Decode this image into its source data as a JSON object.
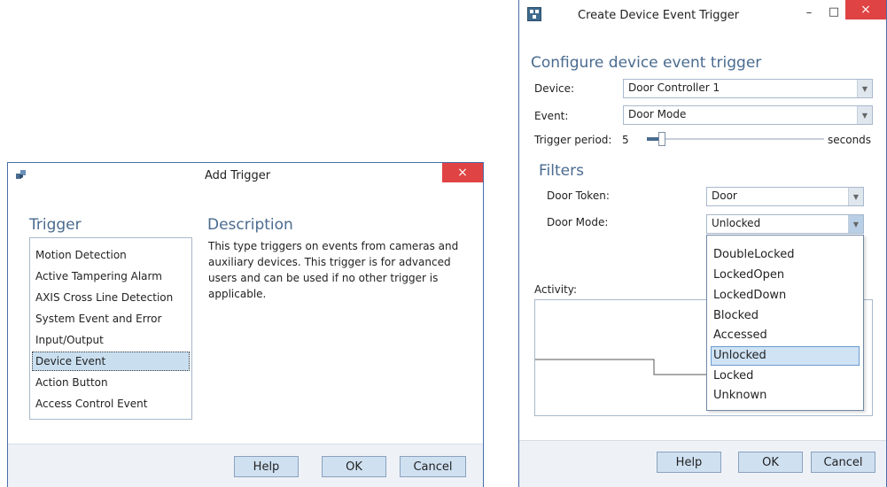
{
  "add_trigger": {
    "title": "Add Trigger",
    "close_glyph": "×",
    "icon_name": "puzzle-icon",
    "trigger_heading": "Trigger",
    "description_heading": "Description",
    "description_text": "This type triggers on events from cameras and auxiliary devices. This trigger is for advanced users and can be used if no other trigger is applicable.",
    "triggers": [
      "Motion Detection",
      "Active Tampering Alarm",
      "AXIS Cross Line Detection",
      "System Event and Error",
      "Input/Output",
      "Device Event",
      "Action Button",
      "Access Control Event"
    ],
    "selected_trigger": "Device Event",
    "buttons": {
      "help": "Help",
      "ok": "OK",
      "cancel": "Cancel"
    }
  },
  "device_event": {
    "title": "Create Device Event Trigger",
    "icon_name": "network-icon",
    "minimize_glyph": "–",
    "maximize_glyph": "□",
    "close_glyph": "×",
    "heading": "Configure device event trigger",
    "device_label": "Device:",
    "device_value": "Door Controller 1",
    "event_label": "Event:",
    "event_value": "Door Mode",
    "trigger_period_label": "Trigger period:",
    "trigger_period_value": "5",
    "trigger_period_unit": "seconds",
    "trigger_period_fraction": 0.07,
    "filters_heading": "Filters",
    "door_token_label": "Door Token:",
    "door_token_value": "Door",
    "door_mode_label": "Door Mode:",
    "door_mode_value": "Unlocked",
    "door_mode_options": [
      "DoubleLocked",
      "LockedOpen",
      "LockedDown",
      "Blocked",
      "Accessed",
      "Unlocked",
      "Locked",
      "Unknown"
    ],
    "door_mode_selected": "Unlocked",
    "activity_label": "Activity:",
    "buttons": {
      "help": "Help",
      "ok": "OK",
      "cancel": "Cancel"
    }
  },
  "colors": {
    "accent_heading": "#4a6b8f",
    "close_red": "#e04343",
    "selection": "#c9dff0",
    "button_fill": "#cfe0f1",
    "border": "#4a6ea9"
  }
}
